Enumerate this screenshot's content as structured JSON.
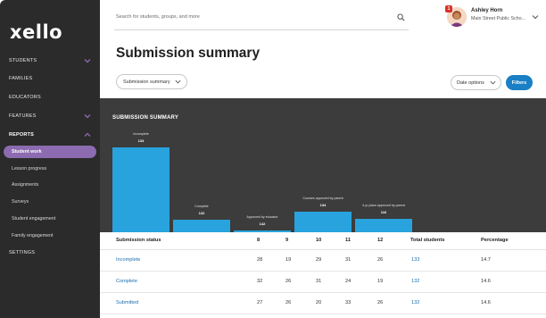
{
  "app": {
    "logo": "xello"
  },
  "sidebar": {
    "items": [
      {
        "label": "STUDENTS",
        "chevron": "down"
      },
      {
        "label": "FAMILIES"
      },
      {
        "label": "EDUCATORS"
      },
      {
        "label": "FEATURES",
        "chevron": "down"
      },
      {
        "label": "REPORTS",
        "chevron": "up"
      }
    ],
    "sub_items": [
      {
        "label": "Student work",
        "active": true
      },
      {
        "label": "Lesson progress"
      },
      {
        "label": "Assignments"
      },
      {
        "label": "Surveys"
      },
      {
        "label": "Student engagement"
      },
      {
        "label": "Family engagement"
      }
    ],
    "settings": "SETTINGS"
  },
  "search": {
    "placeholder": "Search for students, groups, and more",
    "icon": "search-icon"
  },
  "user": {
    "name": "Ashley Horn",
    "school": "Main Street Public Scho...",
    "badge": "1"
  },
  "page": {
    "title": "Submission summary",
    "view_dropdown": "Submission summary",
    "date_options": "Date options",
    "filters": "Filters"
  },
  "chart_data": {
    "type": "bar",
    "title": "SUBMISSION SUMMARY",
    "categories": [
      "Incomplete",
      "Complete",
      "Approved by educator",
      "Courses approved by parent",
      "4-yr plans approved by parent"
    ],
    "values": [
      133,
      132,
      142,
      134,
      116
    ],
    "accent": "#29a3de"
  },
  "table": {
    "headers": [
      "Submission status",
      "8",
      "9",
      "10",
      "11",
      "12",
      "Total students",
      "Percentage"
    ],
    "rows": [
      {
        "status": "Incomplete",
        "g8": "28",
        "g9": "19",
        "g10": "29",
        "g11": "31",
        "g12": "26",
        "total": "133",
        "pct": "14.7"
      },
      {
        "status": "Complete",
        "g8": "32",
        "g9": "26",
        "g10": "31",
        "g11": "24",
        "g12": "19",
        "total": "132",
        "pct": "14.6"
      },
      {
        "status": "Submitted",
        "g8": "27",
        "g9": "26",
        "g10": "20",
        "g11": "33",
        "g12": "26",
        "total": "132",
        "pct": "14.6"
      }
    ]
  }
}
